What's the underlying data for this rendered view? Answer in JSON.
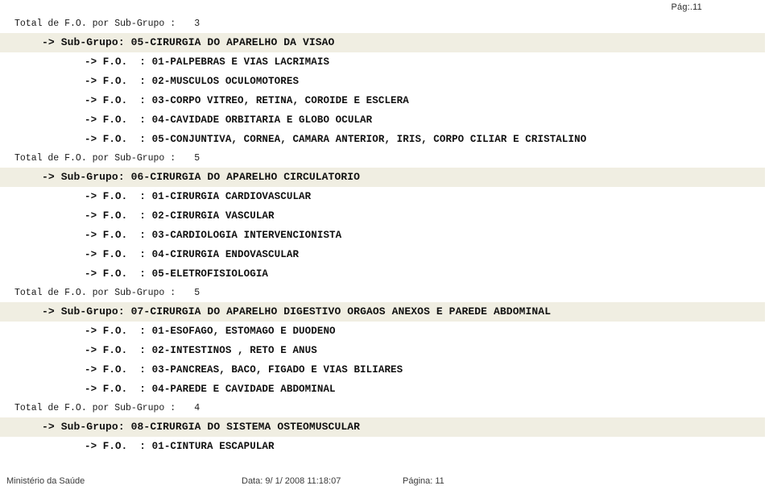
{
  "header": {
    "page_marker": "Pág:.11"
  },
  "labels": {
    "total_prefix": "Total de F.O. por Sub-Grupo :",
    "subgroup_prefix": "-> Sub-Grupo:",
    "fo_prefix": "-> F.O.  :"
  },
  "rows": [
    {
      "type": "total",
      "count": "3"
    },
    {
      "type": "subgroup",
      "text": "-> Sub-Grupo: 05-CIRURGIA DO APARELHO DA VISAO"
    },
    {
      "type": "fo",
      "text": "-> F.O.  : 01-PALPEBRAS E VIAS LACRIMAIS"
    },
    {
      "type": "fo",
      "text": "-> F.O.  : 02-MUSCULOS OCULOMOTORES"
    },
    {
      "type": "fo",
      "text": "-> F.O.  : 03-CORPO VITREO, RETINA, COROIDE E ESCLERA"
    },
    {
      "type": "fo",
      "text": "-> F.O.  : 04-CAVIDADE ORBITARIA E GLOBO OCULAR"
    },
    {
      "type": "fo",
      "text": "-> F.O.  : 05-CONJUNTIVA, CORNEA, CAMARA ANTERIOR, IRIS, CORPO CILIAR E CRISTALINO"
    },
    {
      "type": "total",
      "count": "5"
    },
    {
      "type": "subgroup",
      "text": "-> Sub-Grupo: 06-CIRURGIA DO APARELHO CIRCULATORIO"
    },
    {
      "type": "fo",
      "text": "-> F.O.  : 01-CIRURGIA CARDIOVASCULAR"
    },
    {
      "type": "fo",
      "text": "-> F.O.  : 02-CIRURGIA VASCULAR"
    },
    {
      "type": "fo",
      "text": "-> F.O.  : 03-CARDIOLOGIA INTERVENCIONISTA"
    },
    {
      "type": "fo",
      "text": "-> F.O.  : 04-CIRURGIA ENDOVASCULAR"
    },
    {
      "type": "fo",
      "text": "-> F.O.  : 05-ELETROFISIOLOGIA"
    },
    {
      "type": "total",
      "count": "5"
    },
    {
      "type": "subgroup",
      "text": "-> Sub-Grupo: 07-CIRURGIA DO APARELHO DIGESTIVO ORGAOS ANEXOS E PAREDE ABDOMINAL"
    },
    {
      "type": "fo",
      "text": "-> F.O.  : 01-ESOFAGO, ESTOMAGO E DUODENO"
    },
    {
      "type": "fo",
      "text": "-> F.O.  : 02-INTESTINOS , RETO E ANUS"
    },
    {
      "type": "fo",
      "text": "-> F.O.  : 03-PANCREAS, BACO, FIGADO E VIAS BILIARES"
    },
    {
      "type": "fo",
      "text": "-> F.O.  : 04-PAREDE E CAVIDADE ABDOMINAL"
    },
    {
      "type": "total",
      "count": "4"
    },
    {
      "type": "subgroup",
      "text": "-> Sub-Grupo: 08-CIRURGIA DO SISTEMA OSTEOMUSCULAR"
    },
    {
      "type": "fo",
      "text": "-> F.O.  : 01-CINTURA ESCAPULAR"
    }
  ],
  "footer": {
    "organization": "Ministério da Saúde",
    "date": "Data: 9/ 1/ 2008 11:18:07",
    "page": "Página: 11"
  },
  "colors": {
    "band": "#f0eee2",
    "text": "#111111",
    "page_background": "#ffffff"
  }
}
